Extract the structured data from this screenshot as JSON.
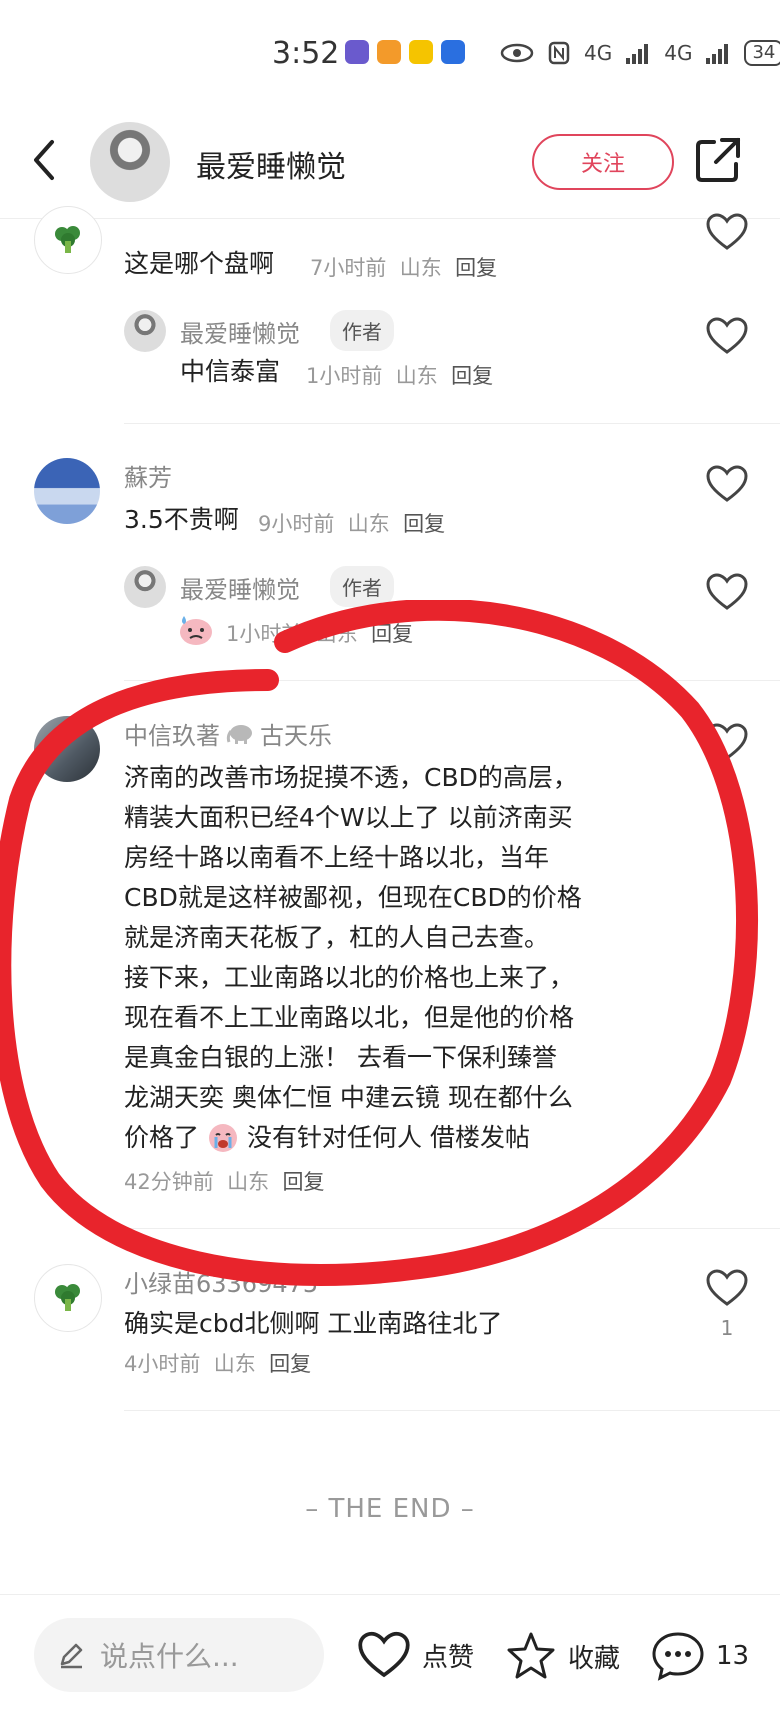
{
  "status_bar": {
    "time": "3:52",
    "battery": "34",
    "net1": "4G",
    "net2": "4G"
  },
  "header": {
    "name": "最爱睡懒觉",
    "follow_label": "关注"
  },
  "comments": [
    {
      "name": "",
      "text": "这是哪个盘啊",
      "time": "7小时前",
      "location": "山东",
      "reply_label": "回复",
      "reply": {
        "name": "最爱睡懒觉",
        "tag": "作者",
        "text": "中信泰富",
        "time": "1小时前",
        "location": "山东",
        "reply_label": "回复"
      }
    },
    {
      "name": "蘇芳",
      "text": "3.5不贵啊",
      "time": "9小时前",
      "location": "山东",
      "reply_label": "回复",
      "reply": {
        "name": "最爱睡懒觉",
        "tag": "作者",
        "time": "1小时前",
        "location": "山东",
        "reply_label": "回复"
      }
    },
    {
      "name": "中信玖著",
      "name_suffix": "古天乐",
      "text_lines": [
        "济南的改善市场捉摸不透，CBD的高层，",
        "精装大面积已经4个W以上了  以前济南买",
        "房经十路以南看不上经十路以北，当年",
        "CBD就是这样被鄙视，但现在CBD的价格",
        "就是济南天花板了，杠的人自己去查。",
        "接下来，工业南路以北的价格也上来了，",
        "现在看不上工业南路以北，但是他的价格",
        "是真金白银的上涨！  去看一下保利臻誉",
        "龙湖天奕 奥体仁恒 中建云镜 现在都什么"
      ],
      "text_last_a": "价格了",
      "text_last_b": "没有针对任何人 借楼发帖",
      "time": "42分钟前",
      "location": "山东",
      "reply_label": "回复"
    },
    {
      "name": "小绿苗63369475",
      "text": "确实是cbd北侧啊 工业南路往北了",
      "time": "4小时前",
      "location": "山东",
      "reply_label": "回复",
      "likes": "1"
    }
  ],
  "end_text": "– THE END –",
  "bottom_bar": {
    "placeholder": "说点什么...",
    "like_label": "点赞",
    "collect_label": "收藏",
    "comment_count": "13"
  },
  "colors": {
    "accent": "#e0455c",
    "marker": "#e8242c"
  }
}
